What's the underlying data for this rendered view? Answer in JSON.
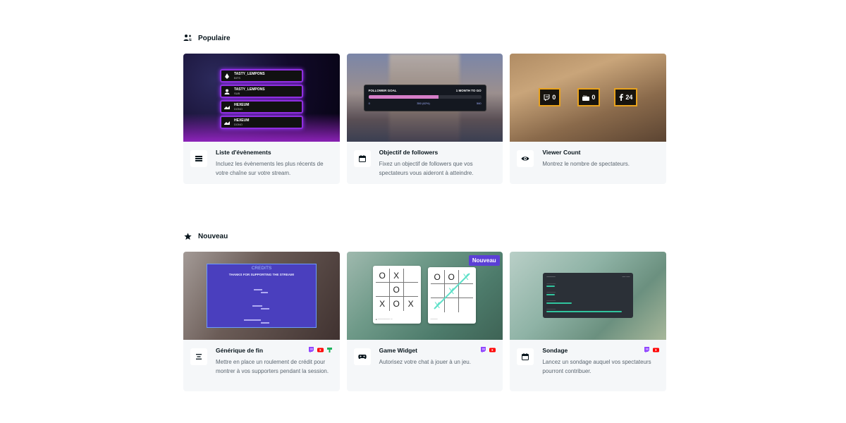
{
  "sections": [
    {
      "title": "Populaire",
      "icon": "trending-users-icon",
      "cards": [
        {
          "name": "Liste d'évènements",
          "description": "Incluez les évènements les plus récents de votre chaîne sur votre stream.",
          "icon": "list-icon",
          "preview": {
            "events": [
              {
                "user": "TASTY_LEMPONS",
                "type": "BITS"
              },
              {
                "user": "TASTY_LEMPONS",
                "type": "SUB"
              },
              {
                "user": "HEXEUM",
                "type": "DONO"
              },
              {
                "user": "HEXEUM",
                "type": "DONO"
              }
            ]
          }
        },
        {
          "name": "Objectif de followers",
          "description": "Fixez un objectif de followers que vos spectateurs vous aideront à atteindre.",
          "icon": "calendar-icon",
          "preview": {
            "title": "FOLLOWER GOAL",
            "deadline": "1 MONTH TO GO",
            "start": "0",
            "progress_text": "350 (62%)",
            "target": "560",
            "progress": 0.62
          }
        },
        {
          "name": "Viewer Count",
          "description": "Montrez le nombre de spectateurs.",
          "icon": "eye-icon",
          "preview": {
            "counts": [
              {
                "platform": "twitch",
                "value": "0"
              },
              {
                "platform": "youtube",
                "value": "0"
              },
              {
                "platform": "facebook",
                "value": "24"
              }
            ]
          }
        }
      ]
    },
    {
      "title": "Nouveau",
      "icon": "star-icon",
      "cards": [
        {
          "name": "Générique de fin",
          "description": "Mettre en place un roulement de crédit pour montrer à vos supporters pendant la session.",
          "icon": "align-center-icon",
          "platforms": [
            "twitch",
            "youtube",
            "trovo"
          ],
          "preview": {
            "title": "CREDITS",
            "subtitle": "THANKS FOR SUPPORTING THE STREAM!"
          }
        },
        {
          "name": "Game Widget",
          "description": "Autorisez votre chat à jouer à un jeu.",
          "icon": "gamepad-icon",
          "platforms": [
            "twitch",
            "youtube"
          ],
          "badge": "Nouveau",
          "preview": {
            "board1": [
              "O",
              "X",
              "",
              "",
              "O",
              "",
              "X",
              "O",
              "X"
            ],
            "board2": [
              "O",
              "O",
              "X",
              "",
              "X",
              "",
              "X",
              "",
              ""
            ]
          }
        },
        {
          "name": "Sondage",
          "description": "Lancez un sondage auquel vos spectateurs pourront contribuer.",
          "icon": "calendar-icon",
          "platforms": [
            "twitch",
            "youtube"
          ],
          "preview": {
            "options": [
              0.1,
              0.1,
              0.3,
              0.9
            ]
          }
        }
      ]
    }
  ],
  "colors": {
    "twitch": "#9146ff",
    "youtube": "#ff0000",
    "trovo": "#1bb35c",
    "badge": "#5b3fd6",
    "card_bg": "#f5f7f9"
  }
}
